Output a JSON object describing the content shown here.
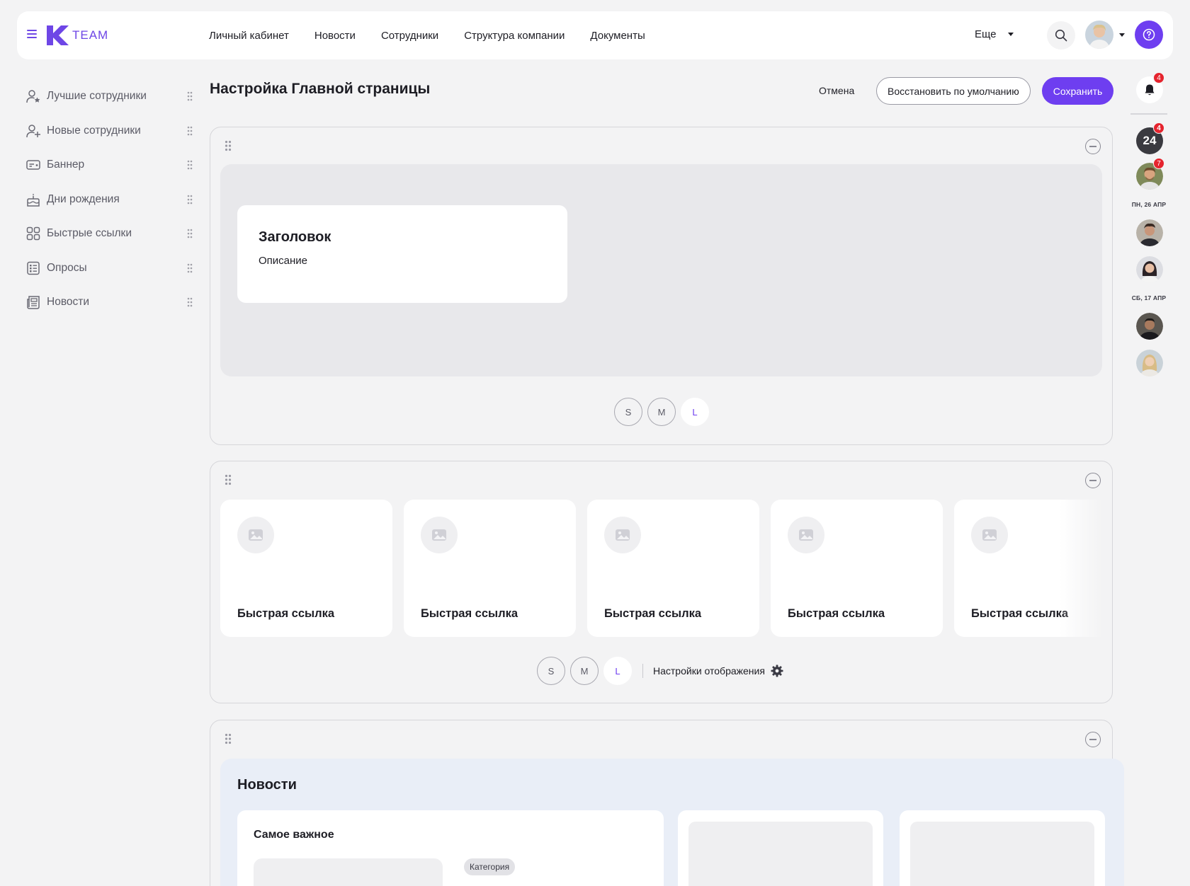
{
  "header": {
    "logo_text": "TEAM",
    "nav": [
      "Личный кабинет",
      "Новости",
      "Сотрудники",
      "Структура компании",
      "Документы"
    ],
    "more_label": "Еще"
  },
  "sidebar": {
    "items": [
      {
        "label": "Лучшие сотрудники",
        "icon": "user-star-icon"
      },
      {
        "label": "Новые сотрудники",
        "icon": "user-add-icon"
      },
      {
        "label": "Баннер",
        "icon": "banner-icon"
      },
      {
        "label": "Дни рождения",
        "icon": "cake-icon"
      },
      {
        "label": "Быстрые ссылки",
        "icon": "grid-icon"
      },
      {
        "label": "Опросы",
        "icon": "poll-icon"
      },
      {
        "label": "Новости",
        "icon": "newspaper-icon"
      }
    ]
  },
  "toolbar": {
    "title": "Настройка Главной страницы",
    "cancel_label": "Отмена",
    "restore_label": "Восстановить по умолчанию",
    "save_label": "Сохранить"
  },
  "banner_block": {
    "card_title": "Заголовок",
    "card_desc": "Описание",
    "sizes": [
      "S",
      "M",
      "L"
    ],
    "active_size": "L"
  },
  "quick_links_block": {
    "links": [
      "Быстрая ссылка",
      "Быстрая ссылка",
      "Быстрая ссылка",
      "Быстрая ссылка",
      "Быстрая ссылка"
    ],
    "sizes": [
      "S",
      "M",
      "L"
    ],
    "active_size": "L",
    "display_settings_label": "Настройки отображения"
  },
  "news_block": {
    "title": "Новости",
    "main_subtitle": "Самое важное",
    "category_badge": "Категория"
  },
  "rail": {
    "bell_badge": "4",
    "calendar_label": "24",
    "calendar_badge": "4",
    "avatar_badge": "7",
    "date_1": "ПН, 26 АПР",
    "date_2": "СБ, 17 АПР"
  },
  "colors": {
    "accent": "#6e3ef0",
    "background": "#f3f3f4",
    "badge": "#e5242e",
    "news_bg": "#e9eef7"
  }
}
